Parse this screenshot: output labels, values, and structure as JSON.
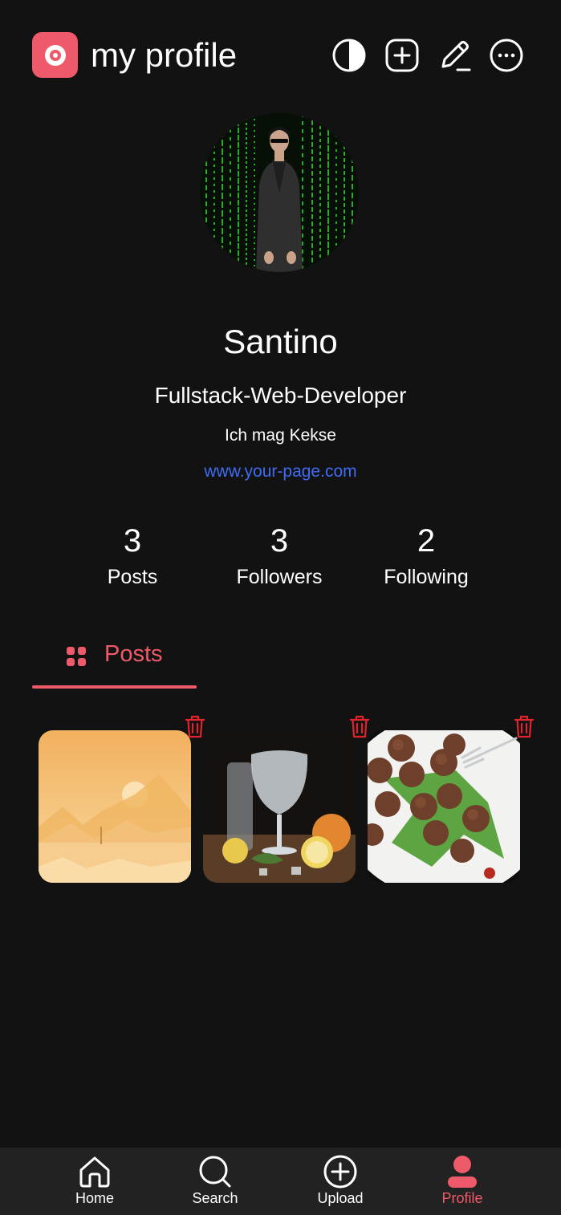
{
  "header": {
    "title": "my profile",
    "logo_icon": "camera-logo-icon",
    "actions": [
      {
        "name": "theme-toggle-icon"
      },
      {
        "name": "add-post-icon"
      },
      {
        "name": "edit-profile-icon"
      },
      {
        "name": "more-options-icon"
      }
    ]
  },
  "profile": {
    "name": "Santino",
    "role": "Fullstack-Web-Developer",
    "bio": "Ich mag Kekse",
    "website": "www.your-page.com"
  },
  "stats": [
    {
      "value": "3",
      "label": "Posts"
    },
    {
      "value": "3",
      "label": "Followers"
    },
    {
      "value": "2",
      "label": "Following"
    }
  ],
  "tabs": {
    "posts_label": "Posts"
  },
  "posts": [
    {
      "name": "post-desert-sunset"
    },
    {
      "name": "post-gin-tonic"
    },
    {
      "name": "post-meatballs"
    }
  ],
  "nav": {
    "home": "Home",
    "search": "Search",
    "upload": "Upload",
    "profile": "Profile",
    "active": "profile"
  },
  "colors": {
    "background": "#121212",
    "accent": "#ef5a6a",
    "link": "#3f6cf2",
    "nav_background": "#222222",
    "delete": "#e0242e"
  }
}
